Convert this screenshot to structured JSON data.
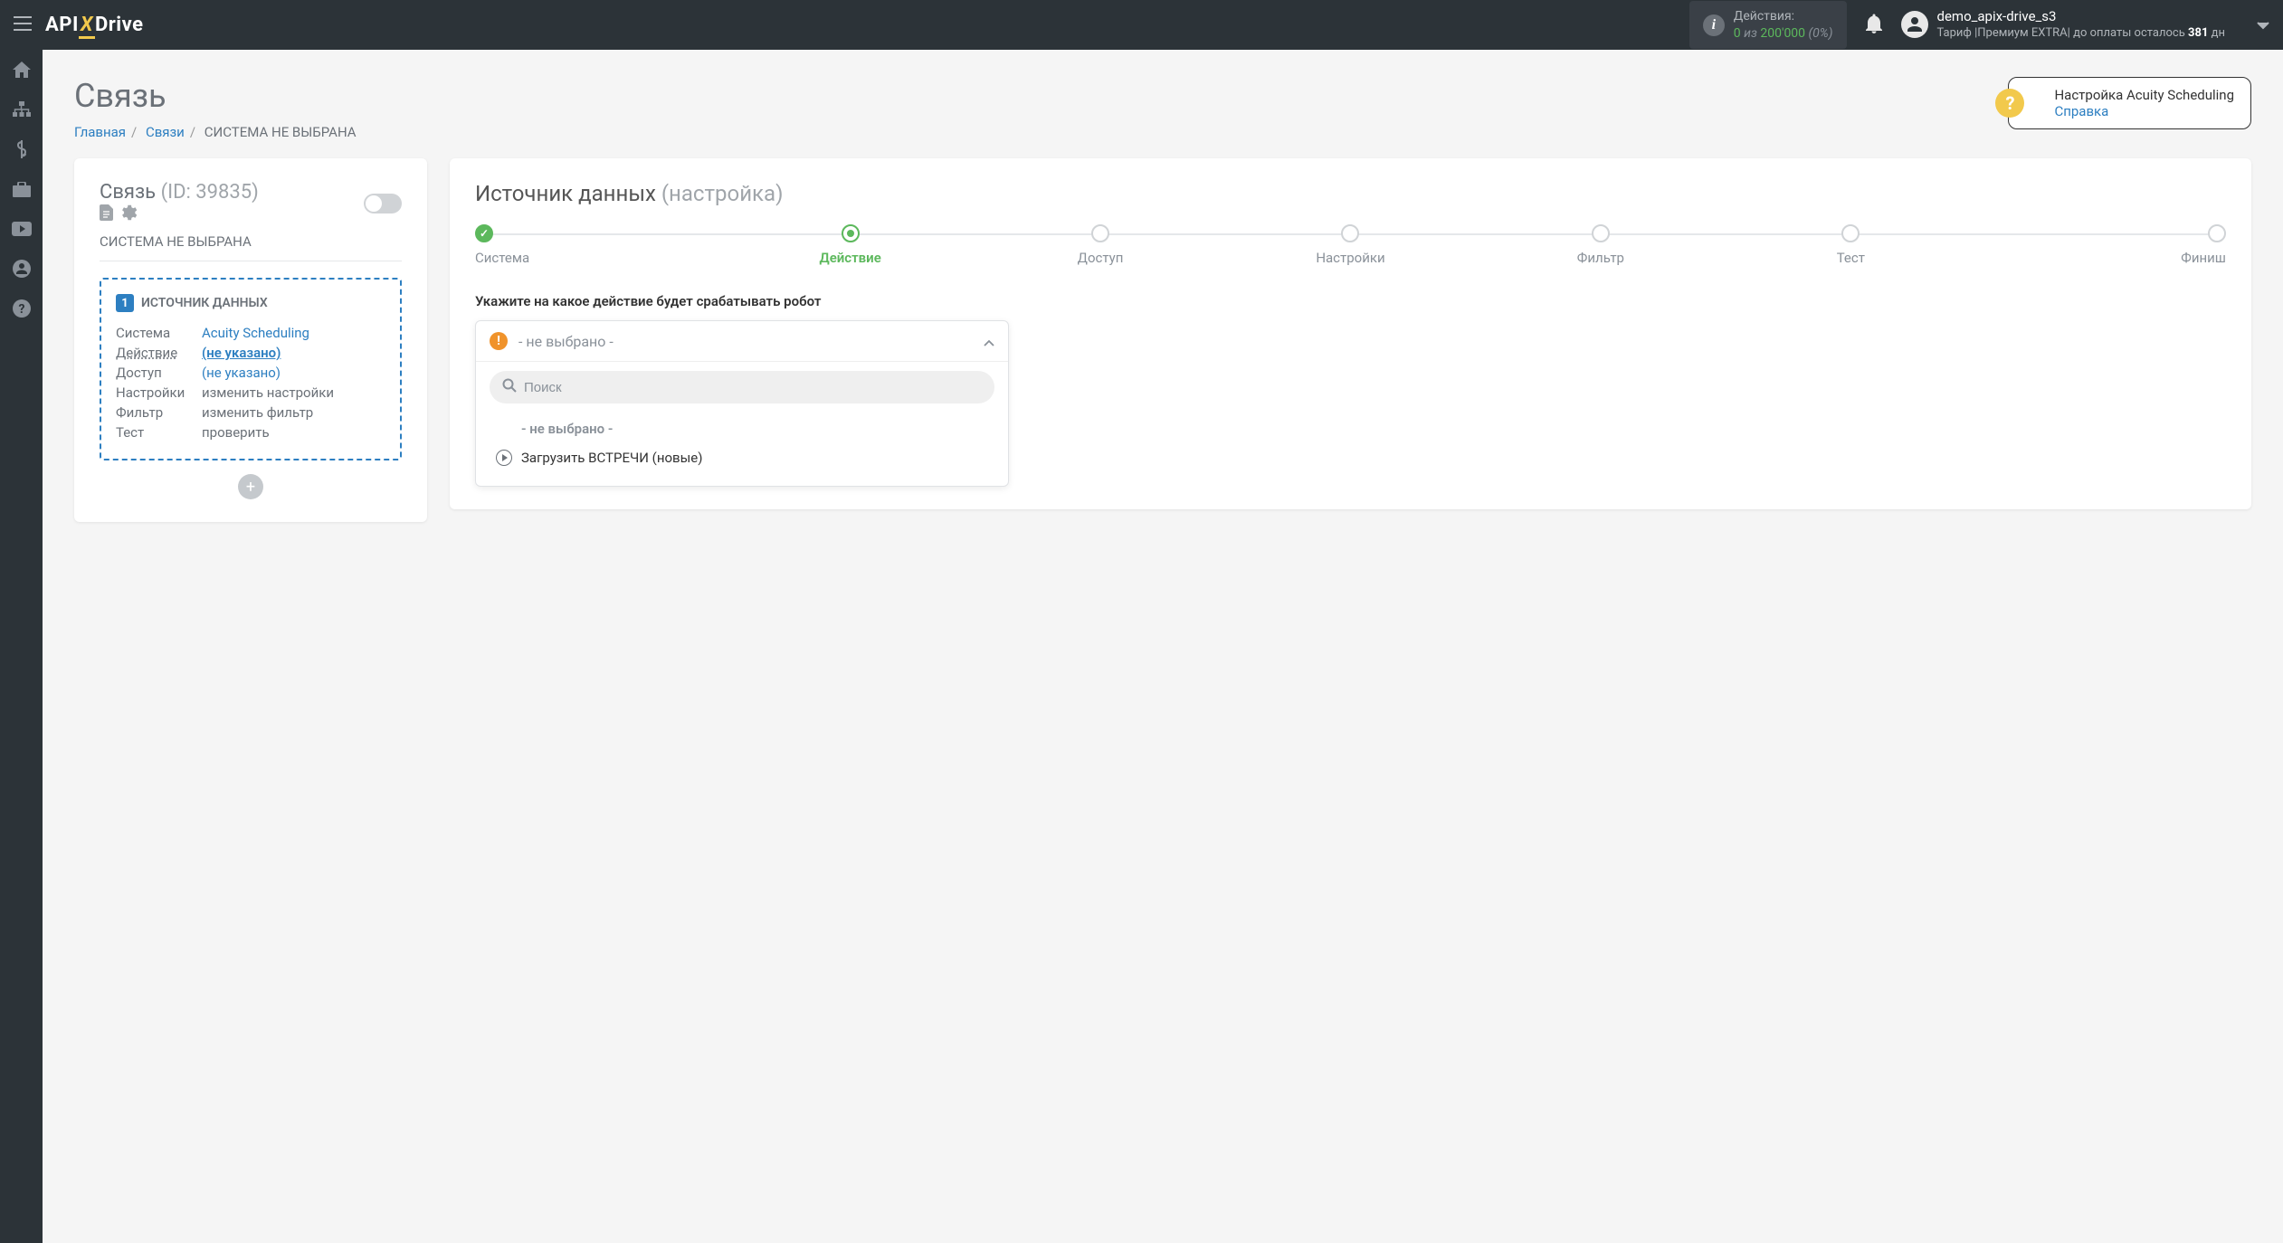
{
  "header": {
    "actions_label": "Действия:",
    "actions_used": "0",
    "actions_of": "из",
    "actions_total": "200'000",
    "actions_pct": "(0%)",
    "user_name": "demo_apix-drive_s3",
    "tariff_prefix": "Тариф |",
    "tariff_name": "Премиум EXTRA",
    "tariff_sep": "|",
    "pay_prefix": "до оплаты осталось",
    "pay_days": "381",
    "pay_suffix": "дн"
  },
  "page": {
    "title": "Связь",
    "breadcrumb": {
      "home": "Главная",
      "links": "Связи",
      "current": "СИСТЕМА НЕ ВЫБРАНА"
    }
  },
  "help": {
    "title": "Настройка Acuity Scheduling",
    "link": "Справка"
  },
  "left_card": {
    "title": "Связь",
    "id": "(ID: 39835)",
    "subtitle": "СИСТЕМА НЕ ВЫБРАНА",
    "box_num": "1",
    "box_title": "ИСТОЧНИК ДАННЫХ",
    "rows": [
      {
        "label": "Система",
        "value": "Acuity Scheduling",
        "link": true
      },
      {
        "label": "Действие",
        "value": "(не указано)",
        "link": true,
        "underline": true
      },
      {
        "label": "Доступ",
        "value": "(не указано)",
        "link": true
      },
      {
        "label": "Настройки",
        "value": "изменить настройки"
      },
      {
        "label": "Фильтр",
        "value": "изменить фильтр"
      },
      {
        "label": "Тест",
        "value": "проверить"
      }
    ]
  },
  "right_card": {
    "title": "Источник данных",
    "title_muted": "(настройка)",
    "steps": [
      "Система",
      "Действие",
      "Доступ",
      "Настройки",
      "Фильтр",
      "Тест",
      "Финиш"
    ],
    "step_active": 1,
    "field_title": "Укажите на какое действие будет срабатывать робот",
    "dropdown_selected": "- не выбрано -",
    "search_placeholder": "Поиск",
    "options": [
      {
        "label": "- не выбрано -",
        "placeholder": true
      },
      {
        "label": "Загрузить ВСТРЕЧИ (новые)"
      }
    ]
  }
}
